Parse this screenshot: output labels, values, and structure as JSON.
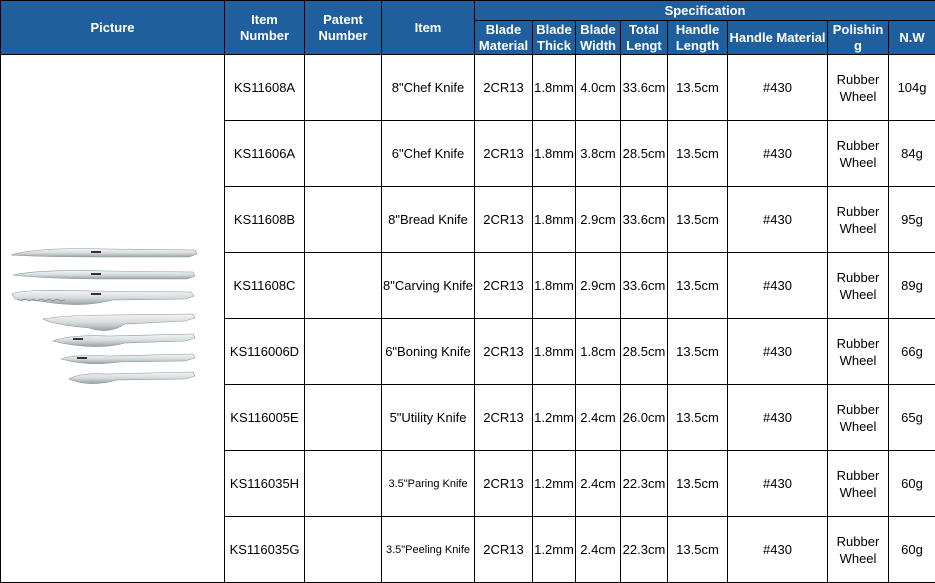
{
  "header": {
    "picture": "Picture",
    "item_number": "Item Number",
    "patent_number": "Patent Number",
    "item": "Item",
    "specification": "Specification",
    "blade_material": "Blade Material",
    "blade_thick": "Blade Thick",
    "blade_width": "Blade Width",
    "total_length": "Total Lengt",
    "handle_length": "Handle Length",
    "handle_material": "Handle Material",
    "polishing": "Polishin g",
    "nw": "N.W"
  },
  "rows": [
    {
      "item_number": "KS11608A",
      "patent_number": "",
      "item": "8\"Chef Knife",
      "blade_material": "2CR13",
      "blade_thick": "1.8mm",
      "blade_width": "4.0cm",
      "total_length": "33.6cm",
      "handle_length": "13.5cm",
      "handle_material": "#430",
      "polishing": "Rubber Wheel",
      "nw": "104g"
    },
    {
      "item_number": "KS11606A",
      "patent_number": "",
      "item": "6\"Chef Knife",
      "blade_material": "2CR13",
      "blade_thick": "1.8mm",
      "blade_width": "3.8cm",
      "total_length": "28.5cm",
      "handle_length": "13.5cm",
      "handle_material": "#430",
      "polishing": "Rubber Wheel",
      "nw": "84g"
    },
    {
      "item_number": "KS11608B",
      "patent_number": "",
      "item": "8\"Bread Knife",
      "blade_material": "2CR13",
      "blade_thick": "1.8mm",
      "blade_width": "2.9cm",
      "total_length": "33.6cm",
      "handle_length": "13.5cm",
      "handle_material": "#430",
      "polishing": "Rubber Wheel",
      "nw": "95g"
    },
    {
      "item_number": "KS11608C",
      "patent_number": "",
      "item": "8\"Carving Knife",
      "blade_material": "2CR13",
      "blade_thick": "1.8mm",
      "blade_width": "2.9cm",
      "total_length": "33.6cm",
      "handle_length": "13.5cm",
      "handle_material": "#430",
      "polishing": "Rubber Wheel",
      "nw": "89g"
    },
    {
      "item_number": "KS116006D",
      "patent_number": "",
      "item": "6\"Boning Knife",
      "blade_material": "2CR13",
      "blade_thick": "1.8mm",
      "blade_width": "1.8cm",
      "total_length": "28.5cm",
      "handle_length": "13.5cm",
      "handle_material": "#430",
      "polishing": "Rubber Wheel",
      "nw": "66g"
    },
    {
      "item_number": "KS116005E",
      "patent_number": "",
      "item": "5\"Utility Knife",
      "blade_material": "2CR13",
      "blade_thick": "1.2mm",
      "blade_width": "2.4cm",
      "total_length": "26.0cm",
      "handle_length": "13.5cm",
      "handle_material": "#430",
      "polishing": "Rubber Wheel",
      "nw": "65g"
    },
    {
      "item_number": "KS116035H",
      "patent_number": "",
      "item": "3.5\"Paring Knife",
      "blade_material": "2CR13",
      "blade_thick": "1.2mm",
      "blade_width": "2.4cm",
      "total_length": "22.3cm",
      "handle_length": "13.5cm",
      "handle_material": "#430",
      "polishing": "Rubber Wheel",
      "nw": "60g"
    },
    {
      "item_number": "KS116035G",
      "patent_number": "",
      "item": "3.5\"Peeling Knife",
      "blade_material": "2CR13",
      "blade_thick": "1.2mm",
      "blade_width": "2.4cm",
      "total_length": "22.3cm",
      "handle_length": "13.5cm",
      "handle_material": "#430",
      "polishing": "Rubber Wheel",
      "nw": "60g"
    }
  ],
  "colors": {
    "header_bg": "#1f5f9e",
    "header_text": "#ffffff"
  },
  "picture_icon": "knife-set-image"
}
